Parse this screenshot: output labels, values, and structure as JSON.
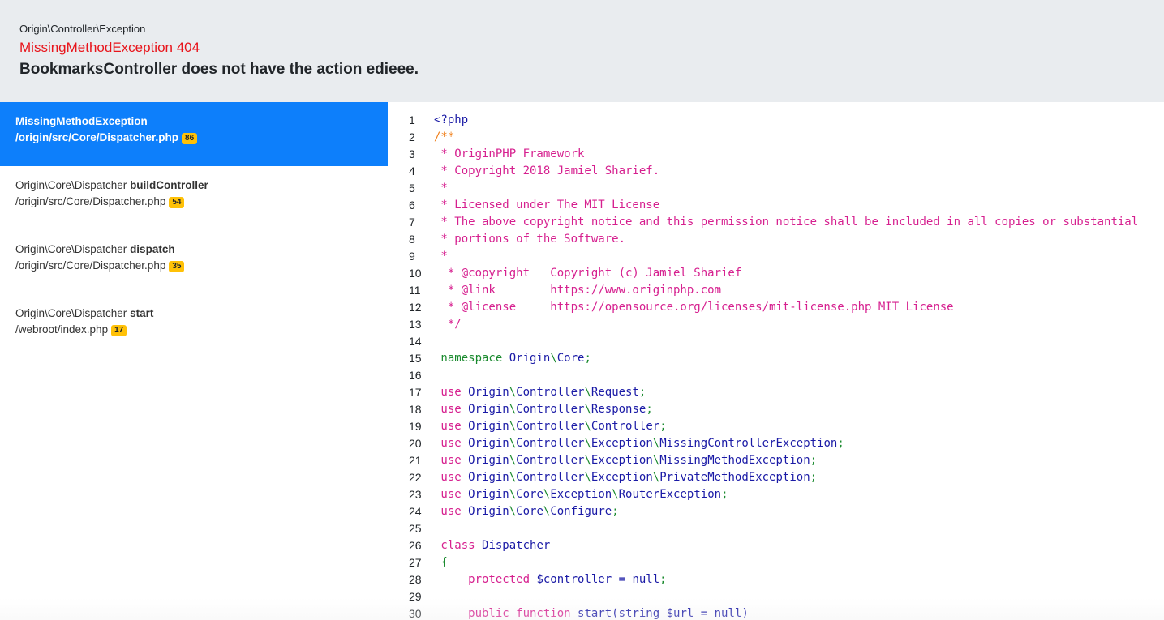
{
  "header": {
    "namespace": "Origin\\Controller\\Exception",
    "exception": "MissingMethodException 404",
    "message": "BookmarksController does not have the action edieee."
  },
  "frames": [
    {
      "class": "MissingMethodException",
      "method": "",
      "path": "/origin/src/Core/Dispatcher.php",
      "line": "86",
      "active": true
    },
    {
      "class": "Origin\\Core\\Dispatcher",
      "method": "buildController",
      "path": "/origin/src/Core/Dispatcher.php",
      "line": "54",
      "active": false
    },
    {
      "class": "Origin\\Core\\Dispatcher",
      "method": "dispatch",
      "path": "/origin/src/Core/Dispatcher.php",
      "line": "35",
      "active": false
    },
    {
      "class": "Origin\\Core\\Dispatcher",
      "method": "start",
      "path": "/webroot/index.php",
      "line": "17",
      "active": false
    }
  ],
  "code": [
    {
      "n": "1",
      "t": [
        [
          "plain",
          "<?php"
        ]
      ]
    },
    {
      "n": "2",
      "t": [
        [
          "doc",
          "/**"
        ]
      ]
    },
    {
      "n": "3",
      "t": [
        [
          "com",
          " * OriginPHP Framework"
        ]
      ]
    },
    {
      "n": "4",
      "t": [
        [
          "com",
          " * Copyright 2018 Jamiel Sharief."
        ]
      ]
    },
    {
      "n": "5",
      "t": [
        [
          "com",
          " *"
        ]
      ]
    },
    {
      "n": "6",
      "t": [
        [
          "com",
          " * Licensed under The MIT License"
        ]
      ]
    },
    {
      "n": "7",
      "t": [
        [
          "com",
          " * The above copyright notice and this permission notice shall be included in all copies or substantial"
        ]
      ]
    },
    {
      "n": "8",
      "t": [
        [
          "com",
          " * portions of the Software."
        ]
      ]
    },
    {
      "n": "9",
      "t": [
        [
          "com",
          " *"
        ]
      ]
    },
    {
      "n": "10",
      "t": [
        [
          "com",
          "  * @copyright   Copyright (c) Jamiel Sharief"
        ]
      ]
    },
    {
      "n": "11",
      "t": [
        [
          "com",
          "  * @link        https://www.originphp.com"
        ]
      ]
    },
    {
      "n": "12",
      "t": [
        [
          "com",
          "  * @license     https://opensource.org/licenses/mit-license.php MIT License"
        ]
      ]
    },
    {
      "n": "13",
      "t": [
        [
          "com",
          "  */"
        ]
      ]
    },
    {
      "n": "14",
      "t": []
    },
    {
      "n": "15",
      "t": [
        [
          "ns",
          " namespace "
        ],
        [
          "id",
          "Origin"
        ],
        [
          "pun",
          "\\"
        ],
        [
          "id",
          "Core"
        ],
        [
          "pun",
          ";"
        ]
      ]
    },
    {
      "n": "16",
      "t": []
    },
    {
      "n": "17",
      "t": [
        [
          "kw",
          " use "
        ],
        [
          "id",
          "Origin"
        ],
        [
          "pun",
          "\\"
        ],
        [
          "id",
          "Controller"
        ],
        [
          "pun",
          "\\"
        ],
        [
          "id",
          "Request"
        ],
        [
          "pun",
          ";"
        ]
      ]
    },
    {
      "n": "18",
      "t": [
        [
          "kw",
          " use "
        ],
        [
          "id",
          "Origin"
        ],
        [
          "pun",
          "\\"
        ],
        [
          "id",
          "Controller"
        ],
        [
          "pun",
          "\\"
        ],
        [
          "id",
          "Response"
        ],
        [
          "pun",
          ";"
        ]
      ]
    },
    {
      "n": "19",
      "t": [
        [
          "kw",
          " use "
        ],
        [
          "id",
          "Origin"
        ],
        [
          "pun",
          "\\"
        ],
        [
          "id",
          "Controller"
        ],
        [
          "pun",
          "\\"
        ],
        [
          "id",
          "Controller"
        ],
        [
          "pun",
          ";"
        ]
      ]
    },
    {
      "n": "20",
      "t": [
        [
          "kw",
          " use "
        ],
        [
          "id",
          "Origin"
        ],
        [
          "pun",
          "\\"
        ],
        [
          "id",
          "Controller"
        ],
        [
          "pun",
          "\\"
        ],
        [
          "id",
          "Exception"
        ],
        [
          "pun",
          "\\"
        ],
        [
          "id",
          "MissingControllerException"
        ],
        [
          "pun",
          ";"
        ]
      ]
    },
    {
      "n": "21",
      "t": [
        [
          "kw",
          " use "
        ],
        [
          "id",
          "Origin"
        ],
        [
          "pun",
          "\\"
        ],
        [
          "id",
          "Controller"
        ],
        [
          "pun",
          "\\"
        ],
        [
          "id",
          "Exception"
        ],
        [
          "pun",
          "\\"
        ],
        [
          "id",
          "MissingMethodException"
        ],
        [
          "pun",
          ";"
        ]
      ]
    },
    {
      "n": "22",
      "t": [
        [
          "kw",
          " use "
        ],
        [
          "id",
          "Origin"
        ],
        [
          "pun",
          "\\"
        ],
        [
          "id",
          "Controller"
        ],
        [
          "pun",
          "\\"
        ],
        [
          "id",
          "Exception"
        ],
        [
          "pun",
          "\\"
        ],
        [
          "id",
          "PrivateMethodException"
        ],
        [
          "pun",
          ";"
        ]
      ]
    },
    {
      "n": "23",
      "t": [
        [
          "kw",
          " use "
        ],
        [
          "id",
          "Origin"
        ],
        [
          "pun",
          "\\"
        ],
        [
          "id",
          "Core"
        ],
        [
          "pun",
          "\\"
        ],
        [
          "id",
          "Exception"
        ],
        [
          "pun",
          "\\"
        ],
        [
          "id",
          "RouterException"
        ],
        [
          "pun",
          ";"
        ]
      ]
    },
    {
      "n": "24",
      "t": [
        [
          "kw",
          " use "
        ],
        [
          "id",
          "Origin"
        ],
        [
          "pun",
          "\\"
        ],
        [
          "id",
          "Core"
        ],
        [
          "pun",
          "\\"
        ],
        [
          "id",
          "Configure"
        ],
        [
          "pun",
          ";"
        ]
      ]
    },
    {
      "n": "25",
      "t": []
    },
    {
      "n": "26",
      "t": [
        [
          "kw",
          " class "
        ],
        [
          "id",
          "Dispatcher"
        ]
      ]
    },
    {
      "n": "27",
      "t": [
        [
          "pun",
          " {"
        ]
      ]
    },
    {
      "n": "28",
      "t": [
        [
          "kw",
          "     protected "
        ],
        [
          "var",
          "$controller"
        ],
        [
          "id",
          " = null"
        ],
        [
          "pun",
          ";"
        ]
      ]
    },
    {
      "n": "29",
      "t": []
    },
    {
      "n": "30",
      "t": [
        [
          "kw",
          "     public function "
        ],
        [
          "id",
          "start(string "
        ],
        [
          "var",
          "$url"
        ],
        [
          "id",
          " = null)"
        ]
      ]
    }
  ],
  "colors": {
    "accent": "#0d7ffb",
    "badge": "#ffc107",
    "exception": "#e8141b",
    "header_bg": "#e9ecef"
  }
}
